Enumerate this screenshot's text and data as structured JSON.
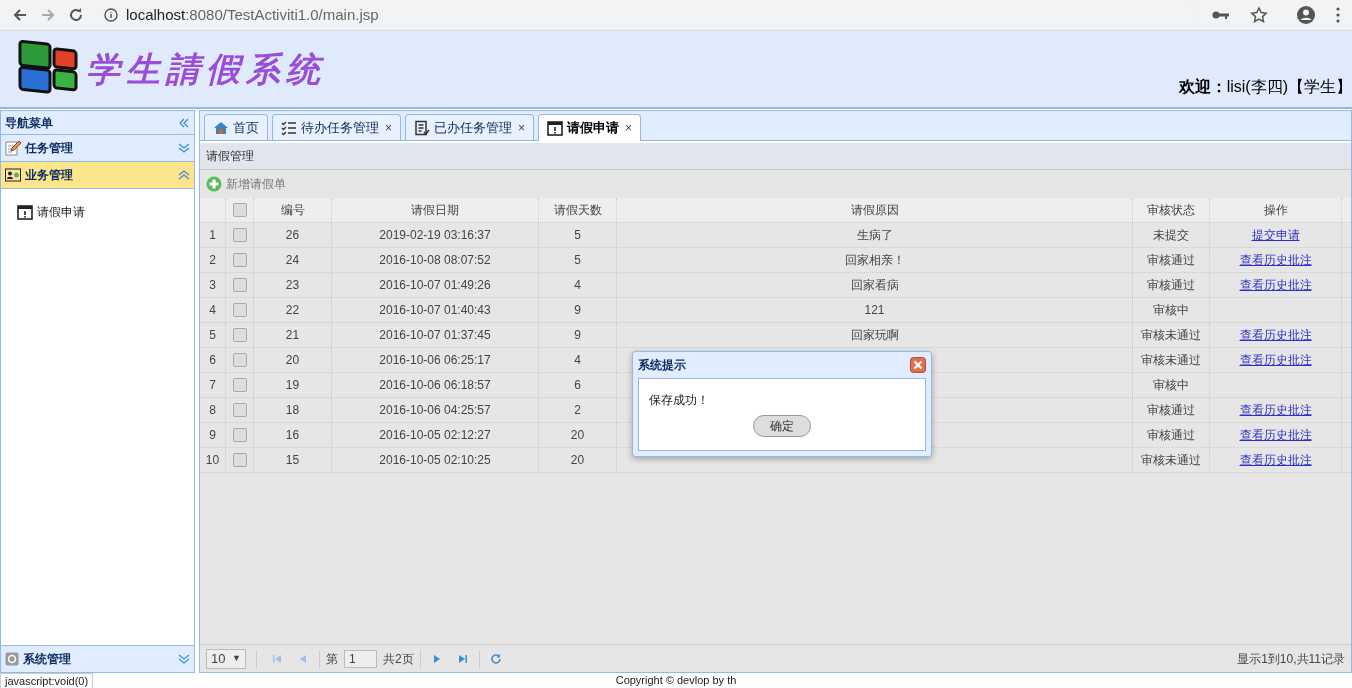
{
  "browser": {
    "url_host": "localhost",
    "url_rest": ":8080/TestActiviti1.0/main.jsp"
  },
  "header": {
    "title": "学生請假系统",
    "welcome_label": "欢迎：",
    "user": "lisi(李四)【学生】"
  },
  "nav": {
    "title": "导航菜单",
    "sections": [
      {
        "label": "任务管理",
        "expanded": false
      },
      {
        "label": "业务管理",
        "expanded": true,
        "items": [
          {
            "label": "请假申请"
          }
        ]
      }
    ],
    "bottom_section": {
      "label": "系统管理",
      "expanded": false
    }
  },
  "tabs": [
    {
      "label": "首页",
      "selected": false,
      "closable": false
    },
    {
      "label": "待办任务管理",
      "selected": false,
      "closable": true
    },
    {
      "label": "已办任务管理",
      "selected": false,
      "closable": true
    },
    {
      "label": "请假申请",
      "selected": true,
      "closable": true
    }
  ],
  "close_glyph": "×",
  "panel": {
    "title": "请假管理",
    "toolbar_button": "新增请假单"
  },
  "table": {
    "header_checked": false,
    "columns": [
      "编号",
      "请假日期",
      "请假天数",
      "请假原因",
      "审核状态",
      "操作"
    ],
    "rows": [
      {
        "n": "1",
        "checked": false,
        "id": "26",
        "date": "2019-02-19 03:16:37",
        "days": "5",
        "reason": "生病了",
        "status": "未提交",
        "action": "提交申请"
      },
      {
        "n": "2",
        "checked": false,
        "id": "24",
        "date": "2016-10-08 08:07:52",
        "days": "5",
        "reason": "回家相亲！",
        "status": "审核通过",
        "action": "查看历史批注"
      },
      {
        "n": "3",
        "checked": false,
        "id": "23",
        "date": "2016-10-07 01:49:26",
        "days": "4",
        "reason": "回家看病",
        "status": "审核通过",
        "action": "查看历史批注"
      },
      {
        "n": "4",
        "checked": false,
        "id": "22",
        "date": "2016-10-07 01:40:43",
        "days": "9",
        "reason": "121",
        "status": "审核中"
      },
      {
        "n": "5",
        "checked": false,
        "id": "21",
        "date": "2016-10-07 01:37:45",
        "days": "9",
        "reason": "回家玩啊",
        "status": "审核未通过",
        "action": "查看历史批注"
      },
      {
        "n": "6",
        "checked": false,
        "id": "20",
        "date": "2016-10-06 06:25:17",
        "days": "4",
        "status": "审核未通过",
        "action": "查看历史批注"
      },
      {
        "n": "7",
        "checked": false,
        "id": "19",
        "date": "2016-10-06 06:18:57",
        "days": "6",
        "status": "审核中"
      },
      {
        "n": "8",
        "checked": false,
        "id": "18",
        "date": "2016-10-06 04:25:57",
        "days": "2",
        "status": "审核通过",
        "action": "查看历史批注"
      },
      {
        "n": "9",
        "checked": false,
        "id": "16",
        "date": "2016-10-05 02:12:27",
        "days": "20",
        "status": "审核通过",
        "action": "查看历史批注"
      },
      {
        "n": "10",
        "checked": false,
        "id": "15",
        "date": "2016-10-05 02:10:25",
        "days": "20",
        "status": "审核未通过",
        "action": "查看历史批注"
      }
    ]
  },
  "pager": {
    "page_size": "10",
    "caret": "▼",
    "page_prefix": "第",
    "page": "1",
    "page_suffix": "共2页",
    "summary": "显示1到10,共11记录"
  },
  "dialog": {
    "title": "系统提示",
    "message": "保存成功！",
    "button": "确定"
  },
  "status_url": "javascript:void(0)",
  "footer": "Copyright © devlop by th"
}
